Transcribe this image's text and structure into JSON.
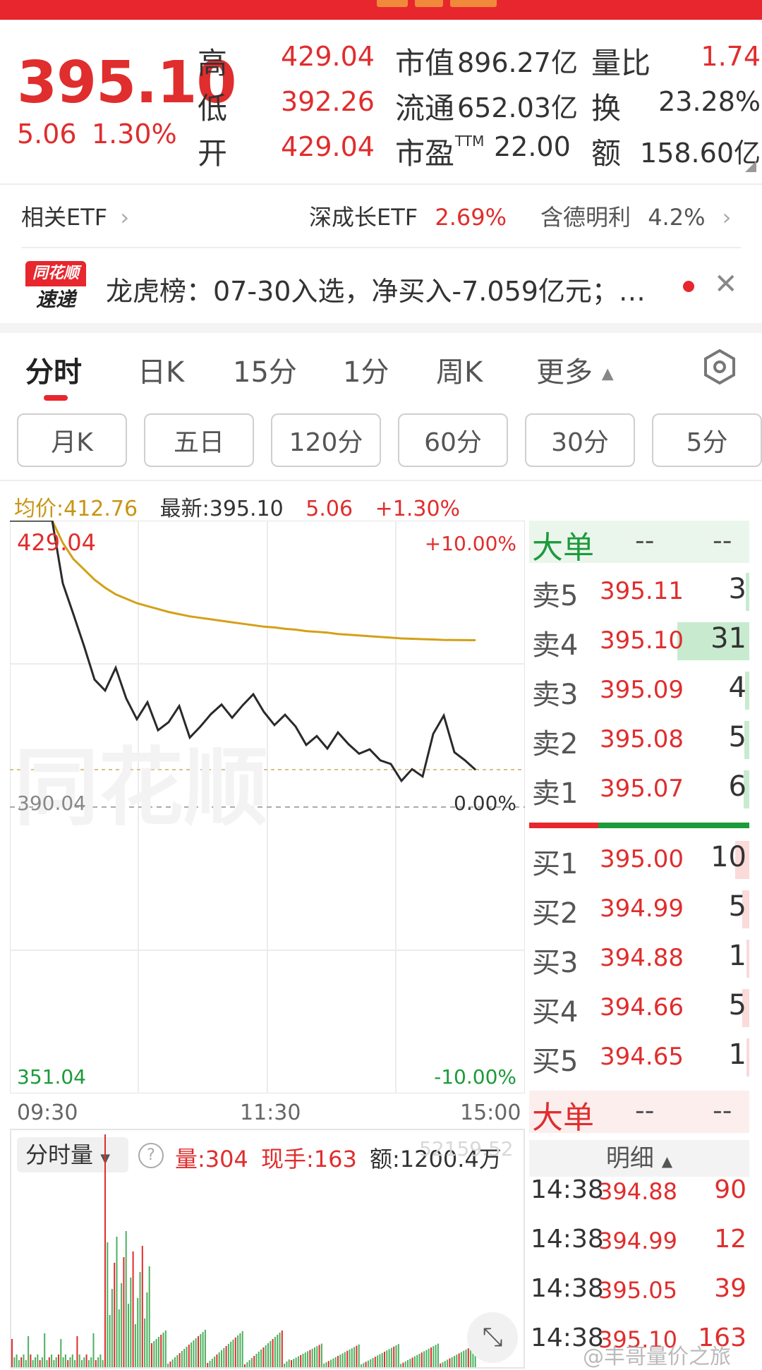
{
  "header": {
    "price": "395.10",
    "change": "5.06",
    "change_pct": "1.30%",
    "quote": [
      {
        "label": "高",
        "value": "429.04"
      },
      {
        "label": "低",
        "value": "392.26"
      },
      {
        "label": "开",
        "value": "429.04"
      }
    ],
    "mid": [
      {
        "label": "市值",
        "value": "896.27亿"
      },
      {
        "label": "流通",
        "value": "652.03亿"
      },
      {
        "label": "市盈",
        "sup": "TTM",
        "value": "22.00"
      }
    ],
    "right": [
      {
        "label": "量比",
        "value": "1.74"
      },
      {
        "label": "换",
        "value": "23.28%"
      },
      {
        "label": "额",
        "value": "158.60亿"
      }
    ]
  },
  "etf": {
    "label": "相关ETF",
    "item1_name": "深成长ETF",
    "item1_pct": "2.69%",
    "item2_name": "含德明利",
    "item2_pct": "4.2%"
  },
  "news": {
    "badge_top": "同花顺",
    "badge_bottom": "速递",
    "text": "龙虎榜：07-30入选，净买入-7.059亿元；…"
  },
  "tabs": [
    "分时",
    "日K",
    "15分",
    "1分",
    "周K",
    "更多"
  ],
  "periods": [
    "月K",
    "五日",
    "120分",
    "60分",
    "30分",
    "5分"
  ],
  "summary": {
    "avg": "均价:412.76",
    "latest": "最新:395.10",
    "change": "5.06",
    "pct": "+1.30%"
  },
  "chart_data": {
    "type": "line",
    "title": "",
    "price_high": "429.04",
    "price_base": "390.04",
    "price_low": "351.04",
    "pct_high": "+10.00%",
    "pct_base": "0.00%",
    "pct_low": "-10.00%",
    "times": [
      "09:30",
      "11:30",
      "15:00"
    ],
    "ylim": [
      351.04,
      429.04
    ],
    "series": [
      {
        "values": [
          429.04,
          429.04,
          429.04,
          429.04,
          429.04,
          420.5,
          416.3,
          412.0,
          407.4,
          405.9,
          409.0,
          404.8,
          402.0,
          404.3,
          400.5,
          401.6,
          403.8,
          399.5,
          401.0,
          402.7,
          404.0,
          402.2,
          403.9,
          405.4,
          403.0,
          401.2,
          402.6,
          401.0,
          398.5,
          399.7,
          398.0,
          400.2,
          398.6,
          397.3,
          397.9,
          396.4,
          395.9,
          393.6,
          395.2,
          394.2,
          400.0,
          402.5,
          397.5,
          396.4,
          395.1
        ]
      },
      {
        "values": [
          429.04,
          429.04,
          429.04,
          429.04,
          429.04,
          426.0,
          423.8,
          422.4,
          421.0,
          419.9,
          419.0,
          418.4,
          417.8,
          417.4,
          417.0,
          416.6,
          416.3,
          416.0,
          415.8,
          415.6,
          415.4,
          415.2,
          415.0,
          414.8,
          414.6,
          414.5,
          414.3,
          414.2,
          414.0,
          413.9,
          413.8,
          413.6,
          413.5,
          413.4,
          413.3,
          413.2,
          413.1,
          413.0,
          412.95,
          412.9,
          412.85,
          412.8,
          412.78,
          412.77,
          412.76
        ]
      }
    ]
  },
  "volume": {
    "label": "分时量",
    "vol": "量:304",
    "hand": "现手:163",
    "amount": "额:1200.4万",
    "max": "52159.52"
  },
  "orderbook": {
    "title": "大单",
    "dash": "--",
    "sells": [
      {
        "label": "卖5",
        "price": "395.11",
        "vol": "3",
        "share": 0.05
      },
      {
        "label": "卖4",
        "price": "395.10",
        "vol": "31",
        "share": 1.0
      },
      {
        "label": "卖3",
        "price": "395.09",
        "vol": "4",
        "share": 0.06
      },
      {
        "label": "卖2",
        "price": "395.08",
        "vol": "5",
        "share": 0.07
      },
      {
        "label": "卖1",
        "price": "395.07",
        "vol": "6",
        "share": 0.08
      }
    ],
    "buys": [
      {
        "label": "买1",
        "price": "395.00",
        "vol": "10",
        "share": 0.2
      },
      {
        "label": "买2",
        "price": "394.99",
        "vol": "5",
        "share": 0.1
      },
      {
        "label": "买3",
        "price": "394.88",
        "vol": "1",
        "share": 0.03
      },
      {
        "label": "买4",
        "price": "394.66",
        "vol": "5",
        "share": 0.1
      },
      {
        "label": "买5",
        "price": "394.65",
        "vol": "1",
        "share": 0.03
      }
    ]
  },
  "detail": {
    "title": "大单",
    "dash": "--",
    "tab": "明细",
    "ticks": [
      {
        "time": "14:38",
        "price": "394.88",
        "vol": "90"
      },
      {
        "time": "14:38",
        "price": "394.99",
        "vol": "12"
      },
      {
        "time": "14:38",
        "price": "395.05",
        "vol": "39"
      },
      {
        "time": "14:38",
        "price": "395.10",
        "vol": "163"
      }
    ]
  },
  "watermark": "@丰哥量价之旅"
}
